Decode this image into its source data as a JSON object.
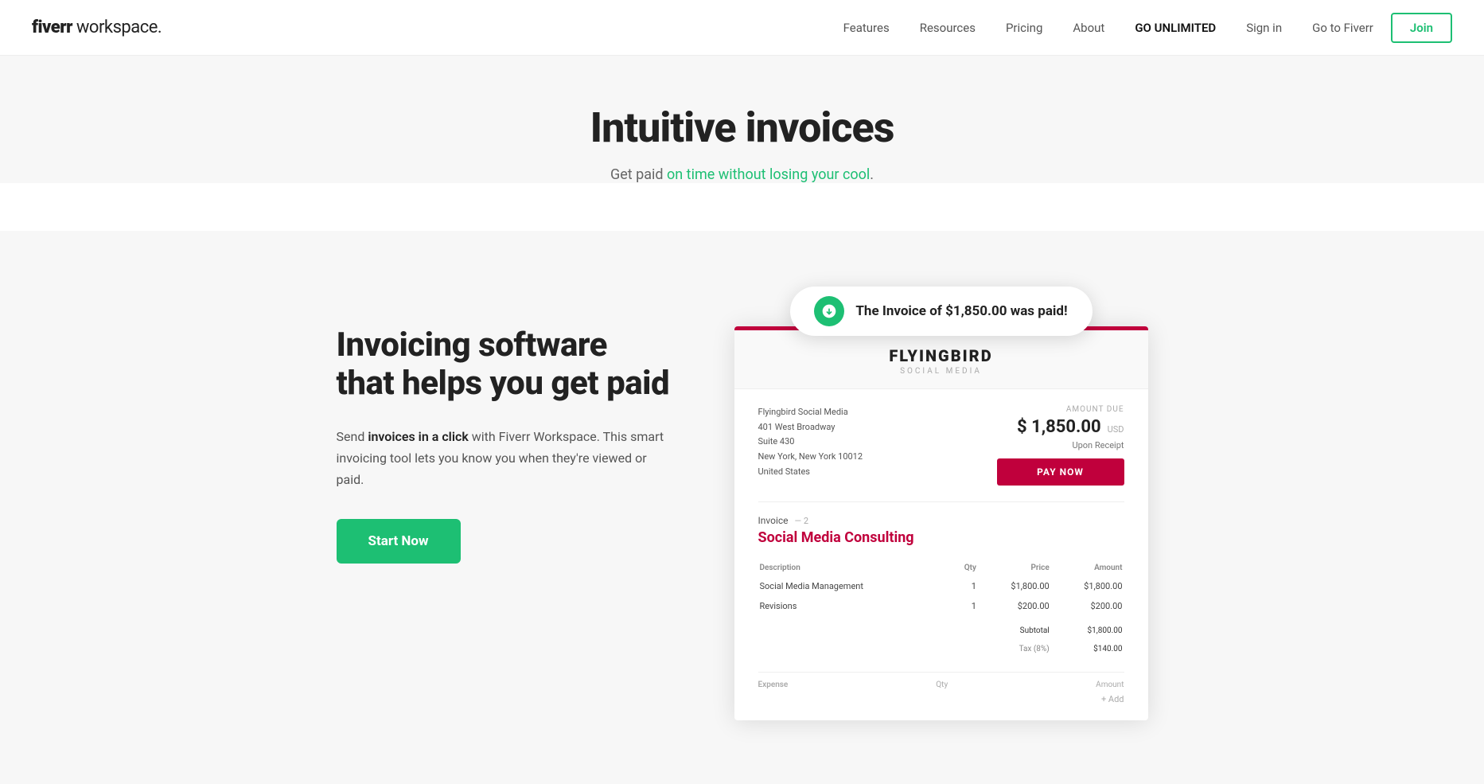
{
  "brand": {
    "logo_bold": "fiverr",
    "logo_light": " workspace."
  },
  "nav": {
    "links": [
      {
        "label": "Features",
        "key": "features"
      },
      {
        "label": "Resources",
        "key": "resources"
      },
      {
        "label": "Pricing",
        "key": "pricing"
      },
      {
        "label": "About",
        "key": "about"
      },
      {
        "label": "GO UNLIMITED",
        "key": "unlimited"
      },
      {
        "label": "Sign in",
        "key": "signin"
      },
      {
        "label": "Go to Fiverr",
        "key": "goto"
      }
    ],
    "join_label": "Join"
  },
  "hero": {
    "title": "Intuitive invoices",
    "subtitle_prefix": "Get paid ",
    "subtitle_highlight": "on time without losing your cool",
    "subtitle_suffix": "."
  },
  "left": {
    "title": "Invoicing software that helps you get paid",
    "description_prefix": "Send ",
    "description_bold": "invoices in a click",
    "description_suffix": " with Fiverr Workspace. This smart invoicing tool lets you know you when they're viewed or paid.",
    "cta": "Start Now"
  },
  "notification": {
    "text": "The Invoice of $1,850.00 was paid!"
  },
  "invoice": {
    "top_border_color": "#c0003c",
    "company_name": "FLYINGBIRD",
    "company_sub": "SOCIAL MEDIA",
    "address_line1": "Flyingbird Social Media",
    "address_line2": "401 West Broadway",
    "address_line3": "Suite 430",
    "address_line4": "New York, New York 10012",
    "address_line5": "United States",
    "amount_label": "Amount Due",
    "amount_value": "$ 1,850.00",
    "amount_currency": "USD",
    "due_label": "Upon Receipt",
    "pay_btn": "PAY NOW",
    "invoice_label": "Invoice",
    "invoice_number": "— 2",
    "service_title": "Social Media Consulting",
    "table": {
      "headers": [
        "Description",
        "Qty",
        "Price",
        "Amount"
      ],
      "rows": [
        [
          "Social Media Management",
          "1",
          "$1,800.00",
          "$1,800.00"
        ],
        [
          "Revisions",
          "1",
          "$200.00",
          "$200.00"
        ]
      ],
      "subtotal_label": "Subtotal",
      "subtotal_value": "$1,800.00",
      "tax_label": "Tax (8%)",
      "tax_value": "$140.00"
    },
    "bottom": {
      "expense_label": "Expense",
      "qty_label": "Qty",
      "amount_label": "Amount",
      "add_label": "+ Add"
    }
  }
}
